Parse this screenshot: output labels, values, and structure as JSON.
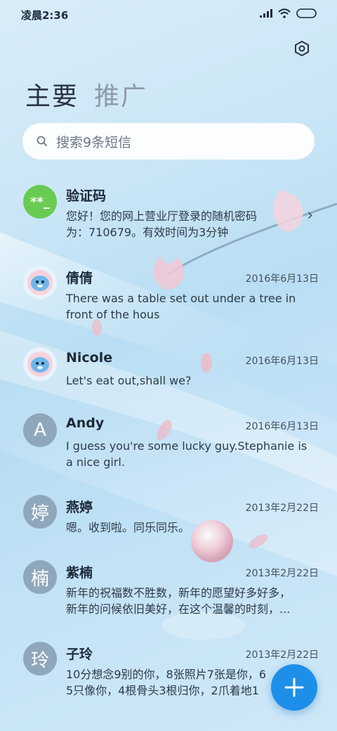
{
  "status": {
    "time": "凌晨2:36"
  },
  "tabs": [
    {
      "label": "主要"
    },
    {
      "label": "推广"
    }
  ],
  "search": {
    "placeholder": "搜索9条短信"
  },
  "messages": [
    {
      "avatar": "**_",
      "name": "验证码",
      "date": "",
      "preview_lines": [
        "您好！您的网上营业厅登录的随机密码",
        "为：710679。有效时间为3分钟"
      ]
    },
    {
      "avatar": "",
      "name": "倩倩",
      "date": "2016年6月13日",
      "preview_lines": [
        "There was a table set out under a tree in",
        "front of the hous"
      ]
    },
    {
      "avatar": "",
      "name": "Nicole",
      "date": "2016年6月13日",
      "preview_lines": [
        "Let's eat out,shall we?"
      ]
    },
    {
      "avatar": "A",
      "name": "Andy",
      "date": "2016年6月13日",
      "preview_lines": [
        "I guess you're some lucky guy.Stephanie is",
        "a nice girl."
      ]
    },
    {
      "avatar": "婷",
      "name": "燕婷",
      "date": "2013年2月22日",
      "preview_lines": [
        "嗯。收到啦。同乐同乐。"
      ]
    },
    {
      "avatar": "楠",
      "name": "紫楠",
      "date": "2013年2月22日",
      "preview_lines": [
        "新年的祝福数不胜数，新年的愿望好多好多，",
        "新年的问候依旧美好，在这个温馨的时刻，..."
      ]
    },
    {
      "avatar": "玲",
      "name": "子玲",
      "date": "2013年2月22日",
      "preview_lines": [
        "10分想念9别的你，8张照片7张是你，6",
        "5只像你，4根骨头3根归你，2爪着地1"
      ]
    }
  ],
  "colors": {
    "fab": "#1e8fe8",
    "code_avatar": "#6acb52",
    "letter_avatar": "#8fa7bb"
  }
}
